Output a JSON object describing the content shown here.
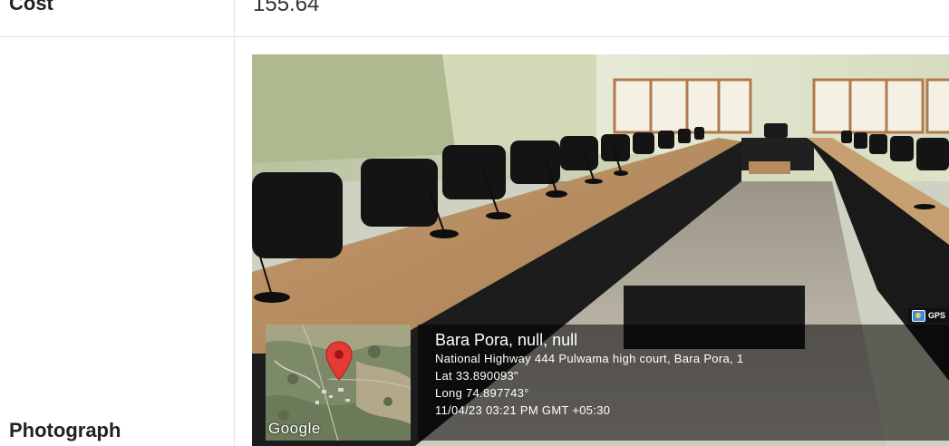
{
  "rows": {
    "cost": {
      "label": "Cost",
      "value": "155.64"
    },
    "photograph": {
      "label": "Photograph"
    }
  },
  "photo": {
    "gps_badge": "GPS",
    "map_brand": "Google",
    "geotag": {
      "place": "Bara Pora, null, null",
      "address": "National Highway 444 Pulwama high court, Bara Pora, 1",
      "lat": "Lat 33.890093\"",
      "long": "Long 74.897743°",
      "timestamp": "11/04/23 03:21 PM GMT +05:30"
    }
  },
  "colors": {
    "overlay_bg": "#000000",
    "pin": "#e53935",
    "text": "#222222"
  }
}
